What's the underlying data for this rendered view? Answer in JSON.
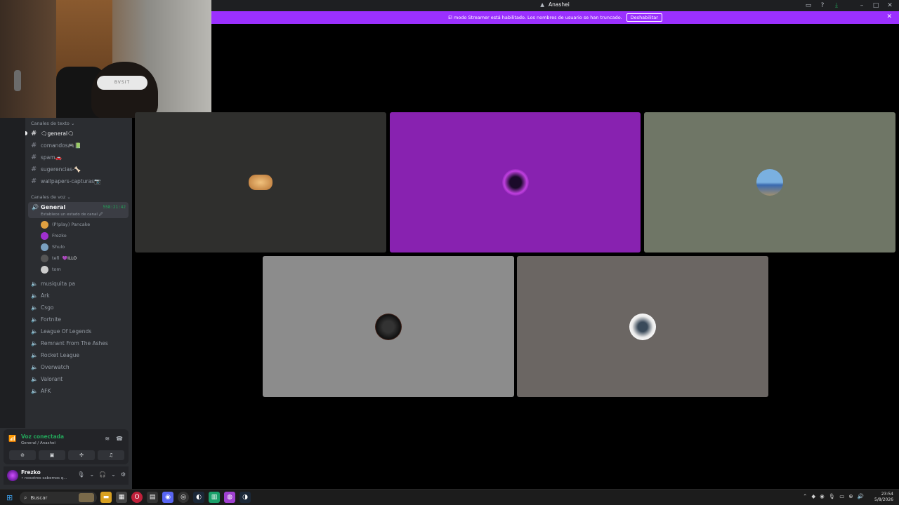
{
  "window": {
    "title": "Anashei",
    "icons": [
      "inbox-icon",
      "help-icon",
      "download-icon",
      "minimize-icon",
      "maximize-icon",
      "close-icon"
    ]
  },
  "banner": {
    "text": "El modo Streamer está habilitado. Los nombres de usuario se han truncado.",
    "button": "Deshabilitar"
  },
  "webcam": {
    "headband_text": "BVSIT"
  },
  "sidebar": {
    "text_category": "Canales de texto",
    "text_channels": [
      {
        "label": "🗨general🗨"
      },
      {
        "label": "comandos🎮📗"
      },
      {
        "label": "spam🚗"
      },
      {
        "label": "sugerencias-🦴"
      },
      {
        "label": "wallpapers-capturas📷"
      }
    ],
    "voice_category": "Canales de voz",
    "active_voice": {
      "name": "General",
      "timer": "558:21:42",
      "status": "Establece un estado de canal 🖉"
    },
    "members": [
      {
        "name": "(P!play) Pancake",
        "tag": ""
      },
      {
        "name": "Frezko",
        "tag": ""
      },
      {
        "name": "Shulo",
        "tag": ""
      },
      {
        "name": "tefi",
        "tag": "💜ILLO"
      },
      {
        "name": "tom",
        "tag": ""
      }
    ],
    "voice_channels": [
      {
        "label": "musiquita pa"
      },
      {
        "label": "Ark"
      },
      {
        "label": "Csgo"
      },
      {
        "label": "Fortnite"
      },
      {
        "label": "League Of Legends"
      },
      {
        "label": "Remnant From The Ashes"
      },
      {
        "label": "Rocket League"
      },
      {
        "label": "Overwatch"
      },
      {
        "label": "Valorant"
      },
      {
        "label": "AFK"
      }
    ]
  },
  "voice_panel": {
    "status": "Voz conectada",
    "location": "General / Anashei"
  },
  "user_panel": {
    "name": "Frezko",
    "status": "• nosotros sabemos q..."
  },
  "tiles": [
    {
      "user": "(P!play) Pancake",
      "color": "#2f2f2d"
    },
    {
      "user": "Frezko",
      "color": "#8822b0"
    },
    {
      "user": "Shulo",
      "color": "#6f7666"
    },
    {
      "user": "tefi",
      "color": "#8c8c8c"
    },
    {
      "user": "tom",
      "color": "#6b6663"
    }
  ],
  "taskbar": {
    "search_placeholder": "Buscar",
    "time": "23:54",
    "date": "5/8/2026"
  }
}
